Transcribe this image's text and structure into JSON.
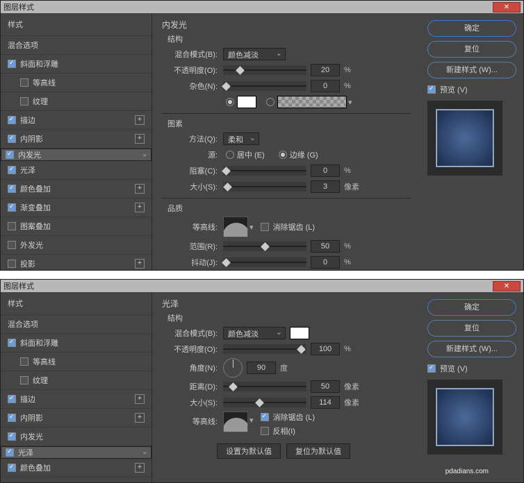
{
  "d1": {
    "title": "图层样式",
    "ok": "确定",
    "reset": "复位",
    "newstyle": "新建样式 (W)...",
    "preview": "预览 (V)",
    "panel_title": "内发光",
    "sidebar": {
      "head": "样式",
      "blend": "混合选项",
      "items": [
        "斜面和浮雕",
        "等高线",
        "纹理",
        "描边",
        "内阴影",
        "内发光",
        "光泽",
        "颜色叠加",
        "渐变叠加",
        "图案叠加",
        "外发光",
        "投影"
      ]
    },
    "struct_t": "结构",
    "blend_l": "混合模式(B):",
    "blend_v": "颜色减淡",
    "opac_l": "不透明度(O):",
    "opac_v": "20",
    "pct": "%",
    "noise_l": "杂色(N):",
    "noise_v": "0",
    "elem_t": "图素",
    "tech_l": "方法(Q):",
    "tech_v": "柔和",
    "src_l": "源:",
    "src_c": "居中 (E)",
    "src_e": "边缘 (G)",
    "choke_l": "阻塞(C):",
    "choke_v": "0",
    "size_l": "大小(S):",
    "size_v": "3",
    "px": "像素",
    "qual_t": "品质",
    "contour_l": "等高线:",
    "aa": "消除锯齿 (L)",
    "range_l": "范围(R):",
    "range_v": "50",
    "jitter_l": "抖动(J):",
    "jitter_v": "0"
  },
  "d2": {
    "title": "图层样式",
    "ok": "确定",
    "reset": "复位",
    "newstyle": "新建样式 (W)...",
    "preview": "预览 (V)",
    "panel_title": "光泽",
    "sidebar": {
      "head": "样式",
      "blend": "混合选项",
      "items": [
        "斜面和浮雕",
        "等高线",
        "纹理",
        "描边",
        "内阴影",
        "内发光",
        "光泽",
        "颜色叠加"
      ]
    },
    "struct_t": "结构",
    "blend_l": "混合模式(B):",
    "blend_v": "颜色减淡",
    "opac_l": "不透明度(O):",
    "opac_v": "100",
    "pct": "%",
    "angle_l": "角度(N):",
    "angle_v": "90",
    "deg": "度",
    "dist_l": "距离(D):",
    "dist_v": "50",
    "px": "像素",
    "size_l": "大小(S):",
    "size_v": "114",
    "contour_l": "等高线:",
    "aa": "消除锯齿 (L)",
    "invert": "反相(I)",
    "defbtn": "设置为默认值",
    "resbtn": "复位为默认值",
    "wm": "pdadians.com"
  }
}
